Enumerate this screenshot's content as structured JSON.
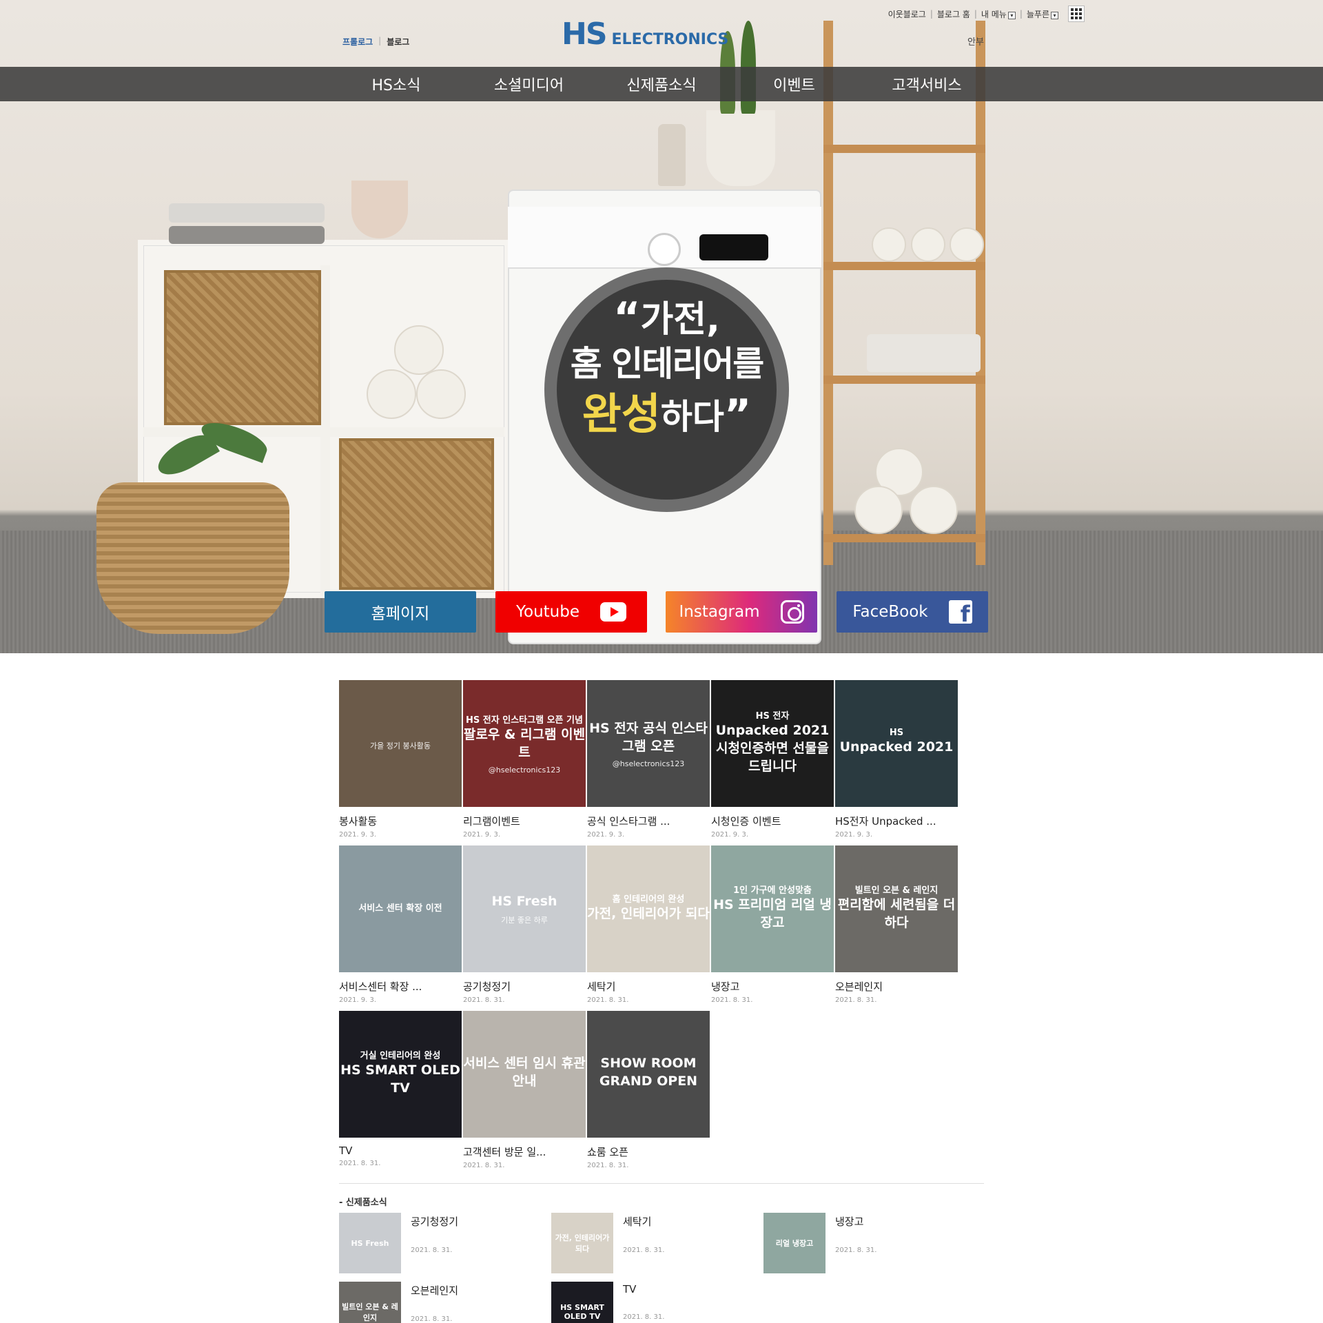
{
  "util_bar": {
    "neighbor_blog": "이웃블로그",
    "blog_home": "블로그 홈",
    "my_menu": "내 메뉴",
    "username": "늘푸른"
  },
  "blog_links": {
    "prologue": "프롤로그",
    "blog": "블로그"
  },
  "logo": {
    "mark": "HS",
    "text": "ELECTRONICS"
  },
  "side_text": "안부",
  "nav": [
    "HS소식",
    "소셜미디어",
    "신제품소식",
    "이벤트",
    "고객서비스"
  ],
  "hero": {
    "line1": "가전,",
    "line2": "홈 인테리어를",
    "highlight": "완성",
    "line3_rest": "하다",
    "open_quote": "“",
    "close_quote": "”"
  },
  "social": {
    "homepage": "홈페이지",
    "youtube": "Youtube",
    "instagram": "Instagram",
    "facebook": "FaceBook"
  },
  "posts": [
    {
      "title": "봉사활동",
      "date": "2021. 9. 3.",
      "thumb_text": [
        "",
        "",
        "가을 정기 봉사활동"
      ],
      "bg": "#6b5a49"
    },
    {
      "title": "리그램이벤트",
      "date": "2021. 9. 3.",
      "thumb_text": [
        "HS 전자 인스타그램 오픈 기념",
        "팔로우 & 리그램 이벤트",
        "@hselectronics123"
      ],
      "bg": "#7a2b2b"
    },
    {
      "title": "공식 인스타그램 ...",
      "date": "2021. 9. 3.",
      "thumb_text": [
        "",
        "HS 전자 공식 인스타그램 오픈",
        "@hselectronics123"
      ],
      "bg": "#4a4a4a"
    },
    {
      "title": "시청인증 이벤트",
      "date": "2021. 9. 3.",
      "thumb_text": [
        "HS 전자",
        "Unpacked 2021 시청인증하면 선물을 드립니다",
        ""
      ],
      "bg": "#1d1d1d"
    },
    {
      "title": "HS전자 Unpacked ...",
      "date": "2021. 9. 3.",
      "thumb_text": [
        "HS",
        "Unpacked 2021",
        ""
      ],
      "bg": "#2a3a40"
    },
    {
      "title": "서비스센터 확장 ...",
      "date": "2021. 9. 3.",
      "thumb_text": [
        "서비스 센터 확장 이전",
        "",
        ""
      ],
      "bg": "#8a9aa0"
    },
    {
      "title": "공기청정기",
      "date": "2021. 8. 31.",
      "thumb_text": [
        "",
        "HS Fresh",
        "기분 좋은 하루"
      ],
      "bg": "#c9ccd0"
    },
    {
      "title": "세탁기",
      "date": "2021. 8. 31.",
      "thumb_text": [
        "홈 인테리어의 완성",
        "가전, 인테리어가 되다",
        ""
      ],
      "bg": "#d8d2c7"
    },
    {
      "title": "냉장고",
      "date": "2021. 8. 31.",
      "thumb_text": [
        "1인 가구에 안성맞춤",
        "HS 프리미엄 리얼 냉장고",
        ""
      ],
      "bg": "#8fa7a0"
    },
    {
      "title": "오븐레인지",
      "date": "2021. 8. 31.",
      "thumb_text": [
        "빌트인 오븐 & 레인지",
        "편리함에 세련됨을 더하다",
        ""
      ],
      "bg": "#6c6a66"
    },
    {
      "title": "TV",
      "date": "2021. 8. 31.",
      "thumb_text": [
        "거실 인테리어의 완성",
        "HS SMART OLED TV",
        ""
      ],
      "bg": "#1b1b22"
    },
    {
      "title": "고객센터 방문 일...",
      "date": "2021. 8. 31.",
      "thumb_text": [
        "",
        "서비스 센터 임시 휴관 안내",
        ""
      ],
      "bg": "#b9b4ad"
    },
    {
      "title": "쇼룸 오픈",
      "date": "2021. 8. 31.",
      "thumb_text": [
        "",
        "SHOW ROOM GRAND OPEN",
        ""
      ],
      "bg": "#4b4b4b"
    }
  ],
  "new_products": {
    "heading": "- 신제품소식",
    "items": [
      {
        "name": "공기청정기",
        "date": "2021. 8. 31.",
        "thumb_label": "HS Fresh",
        "bg": "#c9ccd0"
      },
      {
        "name": "세탁기",
        "date": "2021. 8. 31.",
        "thumb_label": "가전, 인테리어가 되다",
        "bg": "#d8d2c7"
      },
      {
        "name": "냉장고",
        "date": "2021. 8. 31.",
        "thumb_label": "리얼 냉장고",
        "bg": "#8fa7a0"
      },
      {
        "name": "오븐레인지",
        "date": "2021. 8. 31.",
        "thumb_label": "빌트인 오븐 & 레인지",
        "bg": "#6c6a66"
      },
      {
        "name": "TV",
        "date": "2021. 8. 31.",
        "thumb_label": "HS SMART OLED TV",
        "bg": "#1b1b22"
      }
    ]
  }
}
